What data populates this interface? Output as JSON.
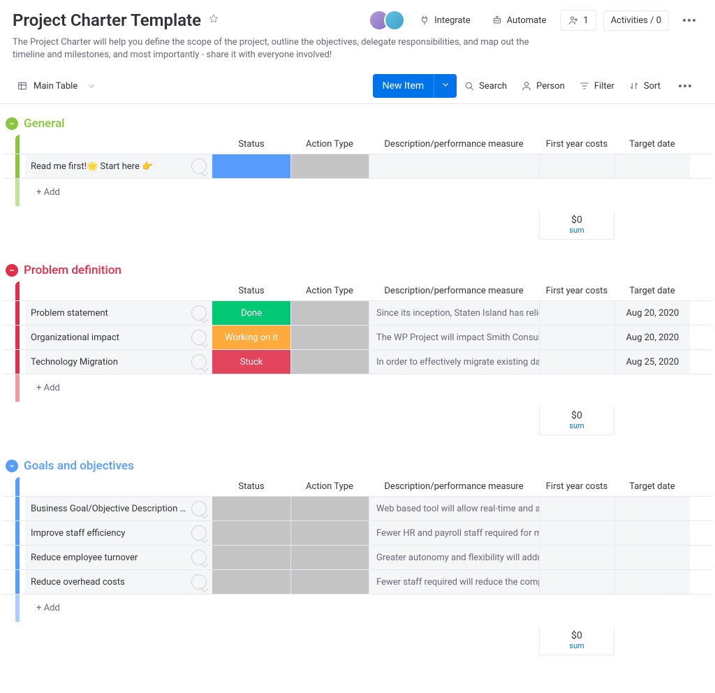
{
  "header": {
    "title": "Project Charter Template",
    "description": "The Project Charter will help you define the scope of the project, outline the objectives, delegate responsibilities, and map out the timeline and milestones, and most importantly - share it with everyone involved!",
    "integrate": "Integrate",
    "automate": "Automate",
    "invite_count": "1",
    "activities_label": "Activities / 0"
  },
  "toolbar": {
    "table_label": "Main Table",
    "new_item": "New Item",
    "search": "Search",
    "person": "Person",
    "filter": "Filter",
    "sort": "Sort"
  },
  "columns": {
    "item": "",
    "status": "Status",
    "action": "Action Type",
    "description": "Description/performance measure",
    "cost": "First year costs",
    "date": "Target date"
  },
  "add_label": "+ Add",
  "sum": {
    "value": "$0",
    "label": "sum"
  },
  "groups": [
    {
      "title": "General",
      "color": "#8ac53e",
      "toggle": "minus",
      "items": [
        {
          "name": "Read me first!🌟 Start here 👉",
          "status": "",
          "status_color": "#579bfc",
          "action_gray": true,
          "description": "",
          "cost": "",
          "date": ""
        }
      ]
    },
    {
      "title": "Problem definition",
      "color": "#df2f4a",
      "toggle": "minus",
      "items": [
        {
          "name": "Problem statement",
          "status": "Done",
          "status_color": "#00c875",
          "action_gray": true,
          "description": "Since its inception, Staten Island has relied up…",
          "cost": "",
          "date": "Aug 20, 2020"
        },
        {
          "name": "Organizational impact",
          "status": "Working on it",
          "status_color": "#fdab3d",
          "action_gray": true,
          "description": "The WP Project will impact Smith Consulting in…",
          "cost": "",
          "date": "Aug 20, 2020"
        },
        {
          "name": "Technology Migration",
          "status": "Stuck",
          "status_color": "#e2445c",
          "action_gray": true,
          "description": "In order to effectively migrate existing data fro…",
          "cost": "",
          "date": "Aug 25, 2020"
        }
      ]
    },
    {
      "title": "Goals and objectives",
      "color": "#579bfc",
      "toggle": "chev",
      "items": [
        {
          "name": "Business Goal/Objective Description Timely a…",
          "status": "",
          "status_color": "#c4c4c4",
          "action_gray": true,
          "description": "Web based tool will allow real-time and accura…",
          "cost": "",
          "date": ""
        },
        {
          "name": "Improve staff efficiency",
          "status": "",
          "status_color": "#c4c4c4",
          "action_gray": true,
          "description": "Fewer HR and payroll staff required for managi…",
          "cost": "",
          "date": ""
        },
        {
          "name": "Reduce employee turnover",
          "status": "",
          "status_color": "#c4c4c4",
          "action_gray": true,
          "description": "Greater autonomy and flexibility will address e…",
          "cost": "",
          "date": ""
        },
        {
          "name": "Reduce overhead costs",
          "status": "",
          "status_color": "#c4c4c4",
          "action_gray": true,
          "description": "Fewer staff required will reduce the company's…",
          "cost": "",
          "date": ""
        }
      ]
    }
  ]
}
